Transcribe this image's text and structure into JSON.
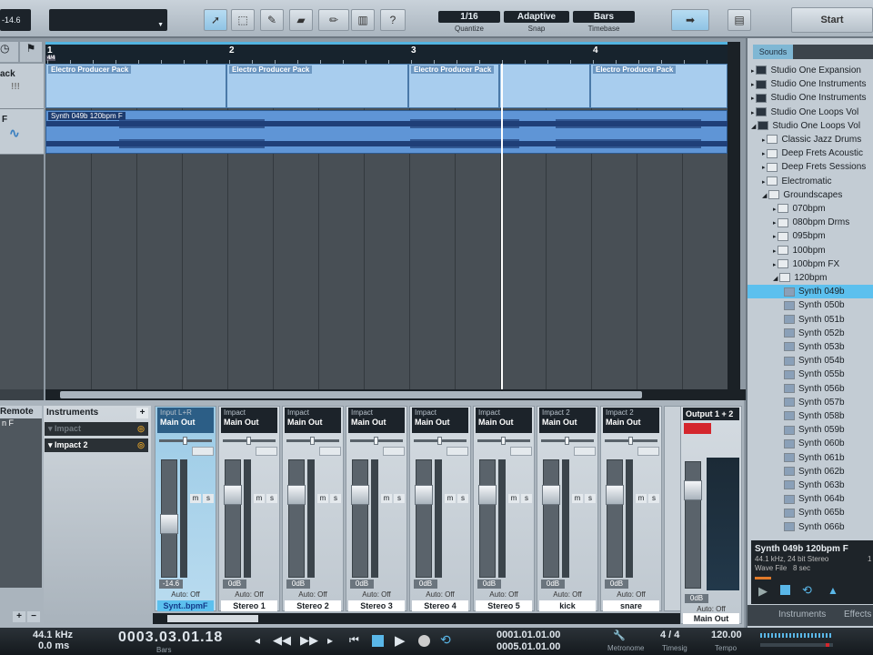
{
  "toolbar": {
    "volume": "-14.6",
    "quantize": {
      "value": "1/16",
      "label": "Quantize"
    },
    "snap": {
      "value": "Adaptive",
      "label": "Snap"
    },
    "timebase": {
      "value": "Bars",
      "label": "Timebase"
    },
    "help": "?",
    "start": "Start"
  },
  "ruler": {
    "bars": [
      "1",
      "2",
      "3",
      "4"
    ],
    "timesig": "4/4"
  },
  "tracks": [
    {
      "name": "ack",
      "icon": "!!!"
    },
    {
      "name": "F"
    }
  ],
  "clips": {
    "instrument": [
      "Electro Producer Pack",
      "Electro Producer Pack",
      "Electro Producer Pack",
      "Electro Producer Pack",
      "Electro Producer Pack"
    ],
    "audio": "Synth 049b 120bpm F"
  },
  "browser": {
    "tab": "Sounds",
    "items": [
      {
        "label": "Studio One Expansion",
        "level": 0,
        "type": "pack"
      },
      {
        "label": "Studio One Instruments",
        "level": 0,
        "type": "pack"
      },
      {
        "label": "Studio One Instruments",
        "level": 0,
        "type": "pack"
      },
      {
        "label": "Studio One Loops Vol",
        "level": 0,
        "type": "pack"
      },
      {
        "label": "Studio One Loops Vol",
        "level": 0,
        "type": "pack",
        "open": true
      },
      {
        "label": "Classic Jazz Drums",
        "level": 1,
        "type": "folder"
      },
      {
        "label": "Deep Frets Acoustic",
        "level": 1,
        "type": "folder"
      },
      {
        "label": "Deep Frets Sessions",
        "level": 1,
        "type": "folder"
      },
      {
        "label": "Electromatic",
        "level": 1,
        "type": "folder"
      },
      {
        "label": "Groundscapes",
        "level": 1,
        "type": "folder",
        "open": true
      },
      {
        "label": "070bpm",
        "level": 2,
        "type": "folder"
      },
      {
        "label": "080bpm Drms",
        "level": 2,
        "type": "folder"
      },
      {
        "label": "095bpm",
        "level": 2,
        "type": "folder"
      },
      {
        "label": "100bpm",
        "level": 2,
        "type": "folder"
      },
      {
        "label": "100bpm FX",
        "level": 2,
        "type": "folder"
      },
      {
        "label": "120bpm",
        "level": 2,
        "type": "folder",
        "open": true
      },
      {
        "label": "Synth 049b",
        "level": 3,
        "type": "file",
        "selected": true
      },
      {
        "label": "Synth 050b",
        "level": 3,
        "type": "file"
      },
      {
        "label": "Synth 051b",
        "level": 3,
        "type": "file"
      },
      {
        "label": "Synth 052b",
        "level": 3,
        "type": "file"
      },
      {
        "label": "Synth 053b",
        "level": 3,
        "type": "file"
      },
      {
        "label": "Synth 054b",
        "level": 3,
        "type": "file"
      },
      {
        "label": "Synth 055b",
        "level": 3,
        "type": "file"
      },
      {
        "label": "Synth 056b",
        "level": 3,
        "type": "file"
      },
      {
        "label": "Synth 057b",
        "level": 3,
        "type": "file"
      },
      {
        "label": "Synth 058b",
        "level": 3,
        "type": "file"
      },
      {
        "label": "Synth 059b",
        "level": 3,
        "type": "file"
      },
      {
        "label": "Synth 060b",
        "level": 3,
        "type": "file"
      },
      {
        "label": "Synth 061b",
        "level": 3,
        "type": "file"
      },
      {
        "label": "Synth 062b",
        "level": 3,
        "type": "file"
      },
      {
        "label": "Synth 063b",
        "level": 3,
        "type": "file"
      },
      {
        "label": "Synth 064b",
        "level": 3,
        "type": "file"
      },
      {
        "label": "Synth 065b",
        "level": 3,
        "type": "file"
      },
      {
        "label": "Synth 066b",
        "level": 3,
        "type": "file"
      }
    ],
    "preview": {
      "title": "Synth 049b 120bpm F",
      "format": "44.1 kHz, 24 bit Stereo",
      "type": "Wave File",
      "length": "8 sec",
      "extra": "1"
    },
    "tabs": [
      "Instruments",
      "Effects"
    ]
  },
  "mixer": {
    "remote": "Remote",
    "remote_track": "n F",
    "instruments_title": "Instruments",
    "instruments": [
      "Impact",
      "Impact 2"
    ],
    "strips": [
      {
        "input": "Input L+R",
        "output": "Main Out",
        "db": "-14.6",
        "auto": "Auto: Off",
        "name": "Synt..bpmF",
        "fader": 0.45,
        "selected": true
      },
      {
        "input": "Impact",
        "output": "Main Out",
        "db": "0dB",
        "auto": "Auto: Off",
        "name": "Stereo 1",
        "fader": 0.75
      },
      {
        "input": "Impact",
        "output": "Main Out",
        "db": "0dB",
        "auto": "Auto: Off",
        "name": "Stereo 2",
        "fader": 0.75
      },
      {
        "input": "Impact",
        "output": "Main Out",
        "db": "0dB",
        "auto": "Auto: Off",
        "name": "Stereo 3",
        "fader": 0.75
      },
      {
        "input": "Impact",
        "output": "Main Out",
        "db": "0dB",
        "auto": "Auto: Off",
        "name": "Stereo 4",
        "fader": 0.75
      },
      {
        "input": "Impact",
        "output": "Main Out",
        "db": "0dB",
        "auto": "Auto: Off",
        "name": "Stereo 5",
        "fader": 0.75
      },
      {
        "input": "Impact 2",
        "output": "Main Out",
        "db": "0dB",
        "auto": "Auto: Off",
        "name": "kick",
        "fader": 0.75
      },
      {
        "input": "Impact 2",
        "output": "Main Out",
        "db": "0dB",
        "auto": "Auto: Off",
        "name": "snare",
        "fader": 0.75
      }
    ],
    "output": {
      "title": "Output 1 + 2",
      "db": "0dB",
      "auto": "Auto: Off",
      "name": "Main Out"
    }
  },
  "transport": {
    "samplerate": "44.1 kHz",
    "latency": "0.0 ms",
    "position": "0003.03.01.18",
    "position_unit": "Bars",
    "loop_start": "0001.01.01.00",
    "loop_end": "0005.01.01.00",
    "metronome": "Metronome",
    "timesig": "4 / 4",
    "timesig_label": "Timesig",
    "tempo": "120.00",
    "tempo_label": "Tempo"
  }
}
